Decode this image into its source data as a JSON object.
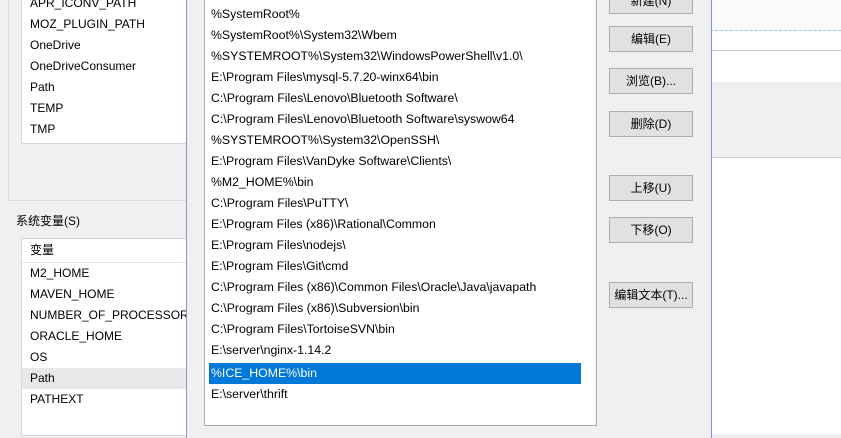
{
  "user_vars": {
    "items": [
      "APR_ICONV_PATH",
      "MOZ_PLUGIN_PATH",
      "OneDrive",
      "OneDriveConsumer",
      "Path",
      "TEMP",
      "TMP"
    ]
  },
  "sys_vars": {
    "label": "系统变量(S)",
    "header": "变量",
    "items": [
      "M2_HOME",
      "MAVEN_HOME",
      "NUMBER_OF_PROCESSORS",
      "ORACLE_HOME",
      "OS",
      "Path",
      "PATHEXT"
    ]
  },
  "path_list": {
    "items": [
      "%SystemRoot%",
      "%SystemRoot%\\System32\\Wbem",
      "%SYSTEMROOT%\\System32\\WindowsPowerShell\\v1.0\\",
      "E:\\Program Files\\mysql-5.7.20-winx64\\bin",
      "C:\\Program Files\\Lenovo\\Bluetooth Software\\",
      "C:\\Program Files\\Lenovo\\Bluetooth Software\\syswow64",
      "%SYSTEMROOT%\\System32\\OpenSSH\\",
      "E:\\Program Files\\VanDyke Software\\Clients\\",
      "%M2_HOME%\\bin",
      "C:\\Program Files\\PuTTY\\",
      "E:\\Program Files (x86)\\Rational\\Common",
      "E:\\Program Files\\nodejs\\",
      "E:\\Program Files\\Git\\cmd",
      "C:\\Program Files (x86)\\Common Files\\Oracle\\Java\\javapath",
      "C:\\Program Files (x86)\\Subversion\\bin",
      "C:\\Program Files\\TortoiseSVN\\bin",
      "E:\\server\\nginx-1.14.2",
      "%ICE_HOME%\\bin",
      "E:\\server\\thrift"
    ],
    "selected_index": 17
  },
  "buttons": {
    "new": "新建(N)",
    "edit": "编辑(E)",
    "browse": "浏览(B)...",
    "delete": "删除(D)",
    "move_up": "上移(U)",
    "move_down": "下移(O)",
    "edit_text": "编辑文本(T)..."
  },
  "colors": {
    "selection": "#0078d7",
    "dialog_border": "#7a9ec7"
  }
}
